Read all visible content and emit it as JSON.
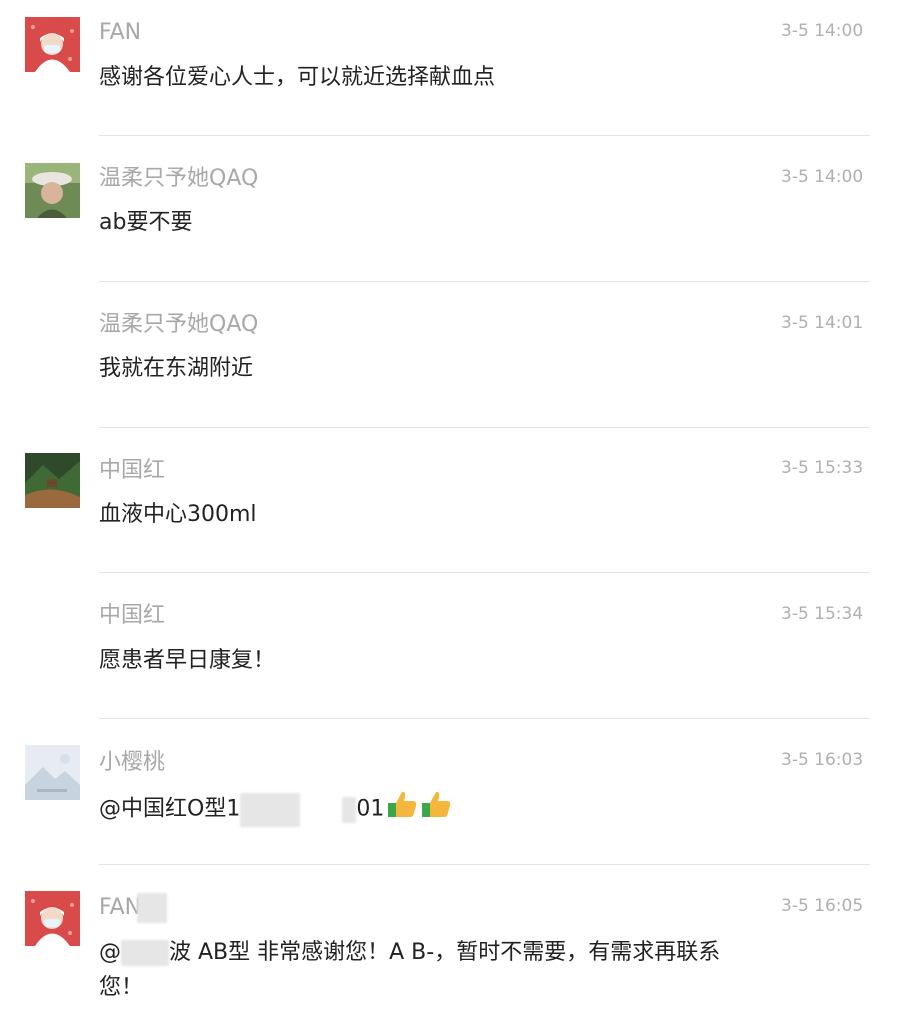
{
  "messages": [
    {
      "name": "FAN",
      "time": "3-5 14:00",
      "text": "感谢各位爱心人士，可以就近选择献血点",
      "avatar": "nurse-avatar"
    },
    {
      "name": "温柔只予她QAQ",
      "time": "3-5 14:00",
      "text": "ab要不要",
      "avatar": "person-hat-avatar"
    },
    {
      "name": "温柔只予她QAQ",
      "time": "3-5 14:01",
      "text": "我就在东湖附近"
    },
    {
      "name": "中国红",
      "time": "3-5 15:33",
      "text": "血液中心300ml",
      "avatar": "landscape-avatar"
    },
    {
      "name": "中国红",
      "time": "3-5 15:34",
      "text": "愿患者早日康复！"
    },
    {
      "name": "小樱桃",
      "time": "3-5 16:03",
      "text_prefix": "@中国红O型1",
      "text_suffix": "01",
      "emojis": [
        "thumbs-up-icon",
        "thumbs-up-icon"
      ],
      "avatar": "default-mountain-avatar"
    },
    {
      "name": "FAN",
      "time": "3-5 16:05",
      "text_prefix": "@",
      "text_mid": "波 AB型 非常感谢您！A B-，暂时不需要，有需求再联系",
      "text_line2": "您！",
      "avatar": "nurse-avatar"
    }
  ],
  "colors": {
    "name": "#a8a8a8",
    "time": "#b0b0b0",
    "text": "#222222",
    "divider": "#e4e4e4",
    "avatar_red": "#d94a4a"
  }
}
